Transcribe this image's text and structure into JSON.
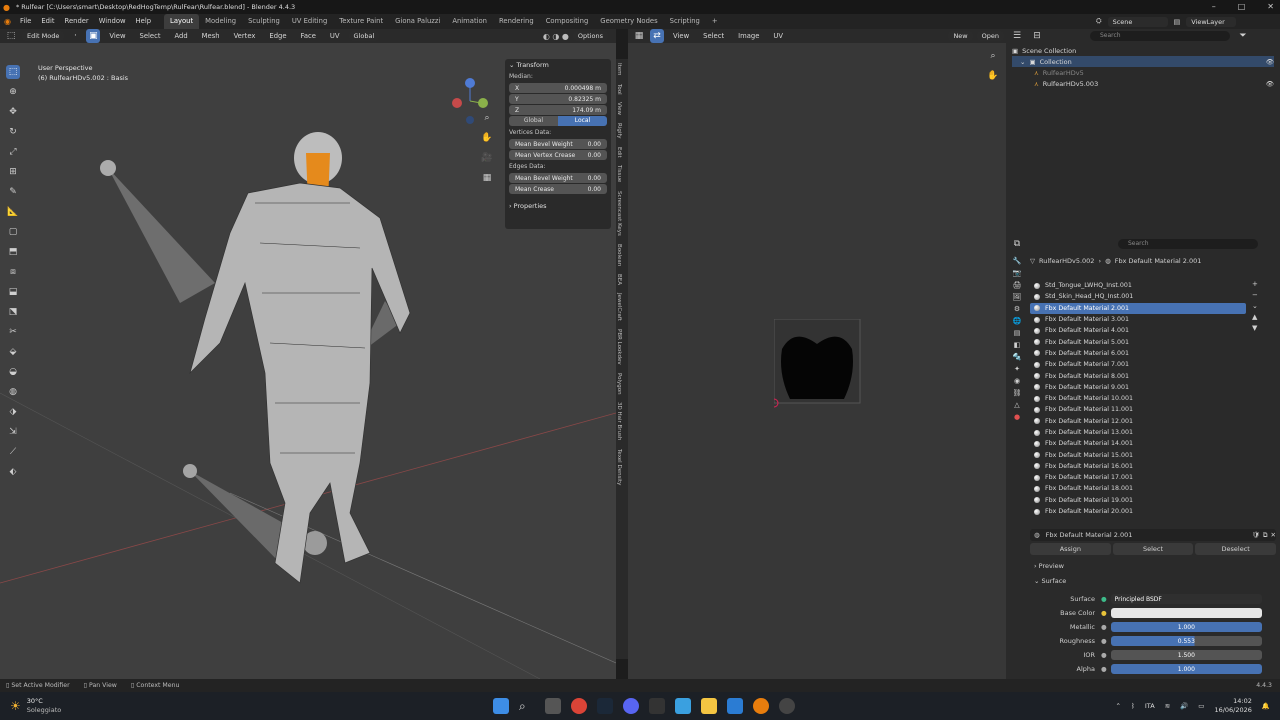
{
  "window": {
    "title": "* Rulfear [C:\\Users\\smart\\Desktop\\RedHogTemp\\RulFear\\Rulfear.blend] - Blender 4.4.3"
  },
  "menubar": {
    "items": [
      "File",
      "Edit",
      "Render",
      "Window",
      "Help"
    ]
  },
  "workspaces": [
    "Layout",
    "Modeling",
    "Sculpting",
    "UV Editing",
    "Texture Paint",
    "Giona Paluzzi",
    "Animation",
    "Rendering",
    "Compositing",
    "Geometry Nodes",
    "Scripting"
  ],
  "scene": {
    "scene_label": "Scene",
    "viewlayer_label": "ViewLayer"
  },
  "viewport": {
    "mode": "Edit Mode",
    "menus": [
      "View",
      "Select",
      "Add",
      "Mesh",
      "Vertex",
      "Edge",
      "Face",
      "UV"
    ],
    "transform_orient": "Global",
    "options_label": "Options",
    "overlay_line1": "User Perspective",
    "overlay_line2": "(6) RulfearHDv5.002 : Basis"
  },
  "npanel": {
    "transform_header": "Transform",
    "median_label": "Median:",
    "x_label": "X",
    "x_value": "0.000498 m",
    "y_label": "Y",
    "y_value": "0.82325 m",
    "z_label": "Z",
    "z_value": "174.09 m",
    "global_btn": "Global",
    "local_btn": "Local",
    "vertices_data": "Vertices Data:",
    "mean_bevel_label": "Mean Bevel Weight",
    "mean_bevel_value": "0.00",
    "mean_vcrease_label": "Mean Vertex Crease",
    "mean_vcrease_value": "0.00",
    "edges_data": "Edges Data:",
    "edge_bevel_label": "Mean Bevel Weight",
    "edge_bevel_value": "0.00",
    "mean_crease_label": "Mean Crease",
    "mean_crease_value": "0.00",
    "properties_header": "Properties"
  },
  "side_tabs": [
    "Item",
    "Tool",
    "View",
    "Rigify",
    "Edit",
    "Tissue",
    "Screencast Keys",
    "Boolean",
    "BEA",
    "JewelCraft",
    "PBR Lookdev",
    "Polygon",
    "3D Hair Brush",
    "Texel Density"
  ],
  "uv_editor": {
    "menus": [
      "View",
      "Select",
      "Image",
      "UV"
    ],
    "new_btn": "New",
    "open_btn": "Open"
  },
  "outliner": {
    "search_placeholder": "Search",
    "scene_collection": "Scene Collection",
    "collection": "Collection",
    "items": [
      "RulfearHDv5",
      "RulfearHDv5.003"
    ]
  },
  "properties": {
    "search_placeholder": "Search",
    "breadcrumb_object": "RulfearHDv5.002",
    "breadcrumb_material": "Fbx Default Material 2.001",
    "materials": [
      "Std_Tongue_LWHQ_Inst.001",
      "Std_Skin_Head_HQ_Inst.001",
      "Fbx Default Material 2.001",
      "Fbx Default Material 3.001",
      "Fbx Default Material 4.001",
      "Fbx Default Material 5.001",
      "Fbx Default Material 6.001",
      "Fbx Default Material 7.001",
      "Fbx Default Material 8.001",
      "Fbx Default Material 9.001",
      "Fbx Default Material 10.001",
      "Fbx Default Material 11.001",
      "Fbx Default Material 12.001",
      "Fbx Default Material 13.001",
      "Fbx Default Material 14.001",
      "Fbx Default Material 15.001",
      "Fbx Default Material 16.001",
      "Fbx Default Material 17.001",
      "Fbx Default Material 18.001",
      "Fbx Default Material 19.001",
      "Fbx Default Material 20.001"
    ],
    "selected_index": 2,
    "material_name": "Fbx Default Material 2.001",
    "assign": "Assign",
    "select": "Select",
    "deselect": "Deselect",
    "preview": "Preview",
    "surface_section": "Surface",
    "surface_label": "Surface",
    "surface_value": "Principled BSDF",
    "base_color_label": "Base Color",
    "metallic_label": "Metallic",
    "metallic_value": "1.000",
    "metallic_fill": 1.0,
    "roughness_label": "Roughness",
    "roughness_value": "0.553",
    "roughness_fill": 0.553,
    "ior_label": "IOR",
    "ior_value": "1.500",
    "alpha_label": "Alpha",
    "alpha_value": "1.000",
    "alpha_fill": 1.0
  },
  "statusbar": {
    "items": [
      "Set Active Modifier",
      "Pan View",
      "Context Menu"
    ],
    "version": "4.4.3"
  },
  "taskbar": {
    "weather_temp": "30°C",
    "weather_desc": "Soleggiato",
    "lang": "ITA",
    "time": "14:02",
    "date": "16/06/2026"
  }
}
